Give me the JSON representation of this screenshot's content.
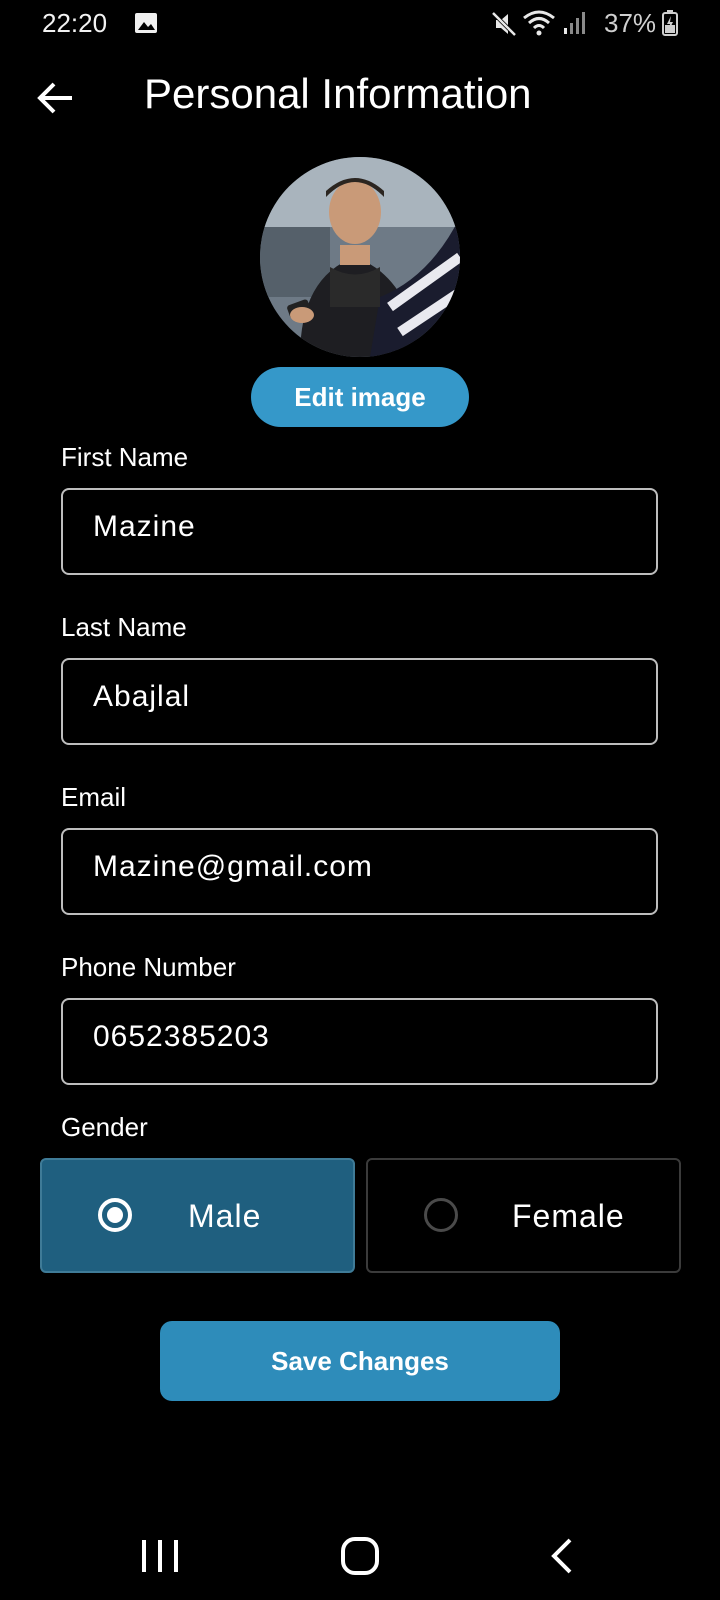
{
  "status_bar": {
    "time": "22:20",
    "battery": "37%",
    "icons": [
      "gallery-icon",
      "mute-icon",
      "wifi-icon",
      "signal-icon",
      "battery-icon"
    ]
  },
  "header": {
    "title": "Personal Information",
    "back_icon": "arrow-left-icon"
  },
  "avatar": {
    "edit_label": "Edit image"
  },
  "form": {
    "first_name": {
      "label": "First Name",
      "value": "Mazine"
    },
    "last_name": {
      "label": "Last Name",
      "value": "Abajlal"
    },
    "email": {
      "label": "Email",
      "value": "Mazine@gmail.com"
    },
    "phone": {
      "label": "Phone Number",
      "value": "0652385203"
    },
    "gender": {
      "label": "Gender",
      "options": [
        {
          "label": "Male",
          "selected": true
        },
        {
          "label": "Female",
          "selected": false
        }
      ]
    }
  },
  "actions": {
    "save_label": "Save Changes"
  },
  "nav_bar": {
    "icons": [
      "recents-icon",
      "home-icon",
      "back-icon"
    ]
  },
  "colors": {
    "background": "#000000",
    "accent": "#3598c9",
    "save_button": "#2e8cba",
    "selected_option": "#1f5f7f",
    "field_border": "#bdbdbd"
  }
}
